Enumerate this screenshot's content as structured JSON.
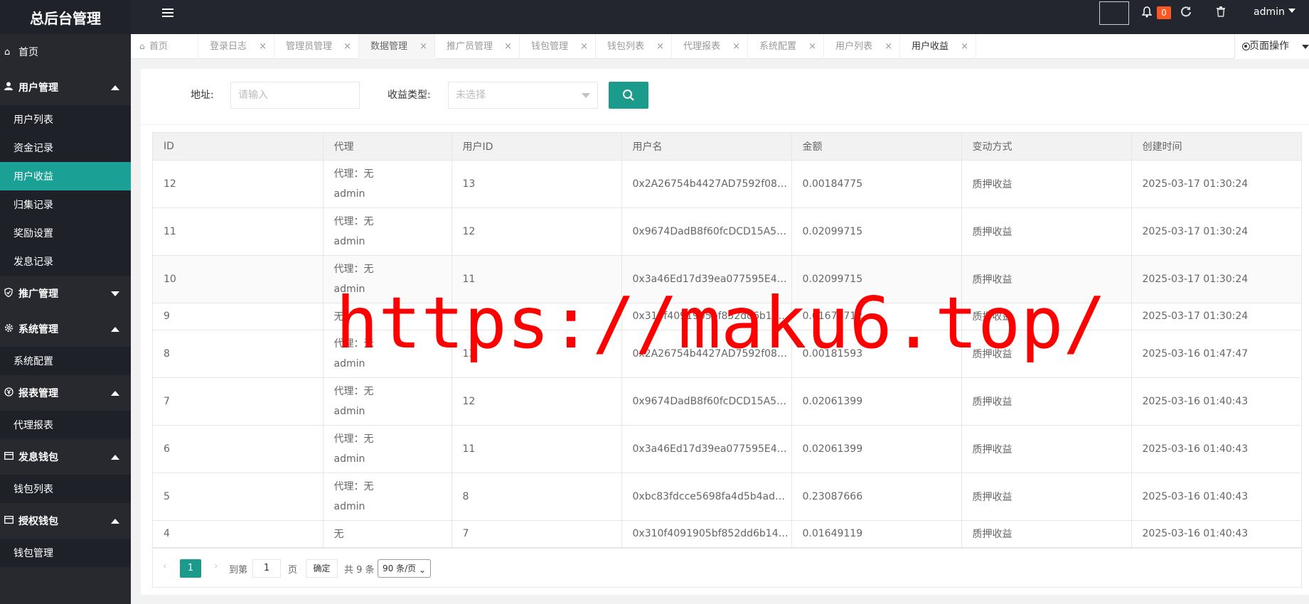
{
  "app": {
    "logo": "总后台管理"
  },
  "header": {
    "notification_count": "0",
    "user": "admin"
  },
  "sidebar": {
    "home": "首页",
    "groups": [
      {
        "label": "用户管理",
        "icon": "user-icon",
        "expanded": true,
        "items": [
          "用户列表",
          "资金记录",
          "用户收益",
          "归集记录",
          "奖励设置",
          "发息记录"
        ]
      },
      {
        "label": "推广管理",
        "icon": "shield-icon",
        "expanded": false,
        "items": []
      },
      {
        "label": "系统管理",
        "icon": "gear-icon",
        "expanded": true,
        "items": [
          "系统配置"
        ]
      },
      {
        "label": "报表管理",
        "icon": "yen-icon",
        "expanded": true,
        "items": [
          "代理报表"
        ]
      },
      {
        "label": "发息钱包",
        "icon": "wallet-icon",
        "expanded": true,
        "items": [
          "钱包列表"
        ]
      },
      {
        "label": "授权钱包",
        "icon": "wallet-icon",
        "expanded": true,
        "items": [
          "钱包管理"
        ]
      }
    ],
    "active_item": "用户收益"
  },
  "tabs": [
    {
      "label": "首页"
    },
    {
      "label": "登录日志"
    },
    {
      "label": "管理员管理"
    },
    {
      "label": "数据管理"
    },
    {
      "label": "推广员管理"
    },
    {
      "label": "钱包管理"
    },
    {
      "label": "钱包列表"
    },
    {
      "label": "代理报表"
    },
    {
      "label": "系统配置"
    },
    {
      "label": "用户列表"
    },
    {
      "label": "用户收益"
    }
  ],
  "active_tab": "用户收益",
  "page_op": "页面操作",
  "filter": {
    "address_label": "地址:",
    "address_placeholder": "请输入",
    "type_label": "收益类型:",
    "type_placeholder": "未选择"
  },
  "table": {
    "columns": [
      "ID",
      "代理",
      "用户ID",
      "用户名",
      "金额",
      "变动方式",
      "创建时间"
    ],
    "rows": [
      {
        "id": "12",
        "agent1": "代理：无",
        "agent2": "admin",
        "uid": "13",
        "name": "0x2A26754b4427AD7592f088...",
        "amount": "0.00184775",
        "type": "质押收益",
        "time": "2025-03-17 01:30:24"
      },
      {
        "id": "11",
        "agent1": "代理：无",
        "agent2": "admin",
        "uid": "12",
        "name": "0x9674DadB8f60fcDCD15A52...",
        "amount": "0.02099715",
        "type": "质押收益",
        "time": "2025-03-17 01:30:24"
      },
      {
        "id": "10",
        "agent1": "代理：无",
        "agent2": "admin",
        "uid": "11",
        "name": "0x3a46Ed17d39ea077595E47...",
        "amount": "0.02099715",
        "type": "质押收益",
        "time": "2025-03-17 01:30:24"
      },
      {
        "id": "9",
        "agent1": "无",
        "agent2": "",
        "uid": "",
        "name": "0x310f4091905bf852dd6b147...",
        "amount": "0.01679712",
        "type": "质押收益",
        "time": "2025-03-17 01:30:24"
      },
      {
        "id": "8",
        "agent1": "代理：无",
        "agent2": "admin",
        "uid": "13",
        "name": "0x2A26754b4427AD7592f088...",
        "amount": "0.00181593",
        "type": "质押收益",
        "time": "2025-03-16 01:47:47"
      },
      {
        "id": "7",
        "agent1": "代理：无",
        "agent2": "admin",
        "uid": "12",
        "name": "0x9674DadB8f60fcDCD15A52...",
        "amount": "0.02061399",
        "type": "质押收益",
        "time": "2025-03-16 01:40:43"
      },
      {
        "id": "6",
        "agent1": "代理：无",
        "agent2": "admin",
        "uid": "11",
        "name": "0x3a46Ed17d39ea077595E47...",
        "amount": "0.02061399",
        "type": "质押收益",
        "time": "2025-03-16 01:40:43"
      },
      {
        "id": "5",
        "agent1": "代理：无",
        "agent2": "admin",
        "uid": "8",
        "name": "0xbc83fdcce5698fa4d5b4ad9b...",
        "amount": "0.23087666",
        "type": "质押收益",
        "time": "2025-03-16 01:40:43"
      },
      {
        "id": "4",
        "agent1": "无",
        "agent2": "",
        "uid": "7",
        "name": "0x310f4091905bf852dd6b147...",
        "amount": "0.01649119",
        "type": "质押收益",
        "time": "2025-03-16 01:40:43"
      }
    ]
  },
  "pager": {
    "current": "1",
    "goto_label": "到第",
    "goto_value": "1",
    "page_suffix": "页",
    "confirm": "确定",
    "total": "共 9 条",
    "page_size": "90 条/页"
  },
  "watermark": "https://maku6.top/",
  "colors": {
    "accent": "#1b9b8c",
    "sidebar_active": "#1aa094",
    "header_bg": "#23262e",
    "badge": "#ff5722"
  }
}
